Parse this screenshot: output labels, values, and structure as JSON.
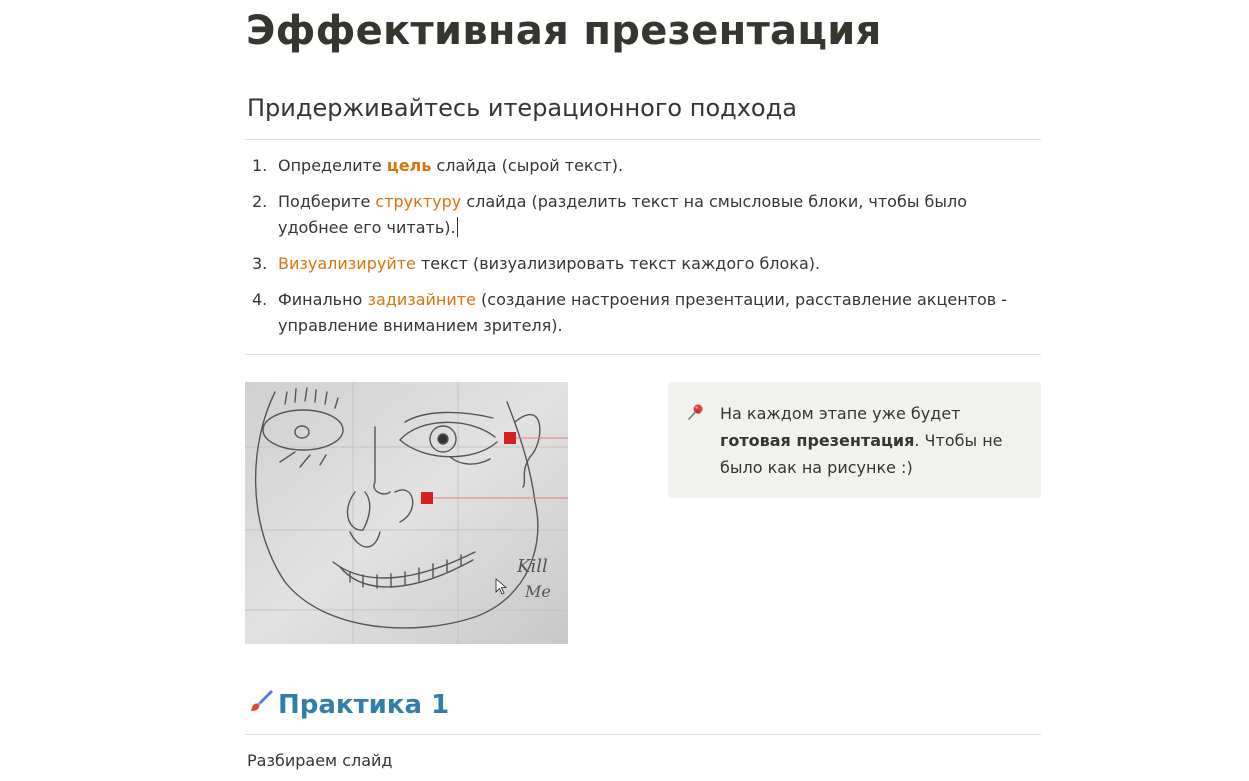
{
  "page": {
    "title": "Эффективная презентация",
    "subtitle": "Придерживайтесь итерационного подхода"
  },
  "steps": [
    {
      "num": "1.",
      "before": "Определите ",
      "highlight": "цель",
      "after": " слайда (сырой текст)."
    },
    {
      "num": "2.",
      "before": "Подберите ",
      "highlight": "структуру",
      "after": " слайда (разделить текст на смысловые блоки, чтобы было удобнее его читать)."
    },
    {
      "num": "3.",
      "before": "",
      "highlight": "Визуализируйте",
      "after": " текст (визуализировать текст каждого блока)."
    },
    {
      "num": "4.",
      "before": "Финально ",
      "highlight": "задизайните",
      "after": " (создание настроения презентации, расставление акцентов - управление вниманием зрителя)."
    }
  ],
  "callout": {
    "icon": "pushpin-icon",
    "text_before": "На каждом этапе уже будет ",
    "text_bold": "готовая презентация",
    "text_after": ". Чтобы не было как на рисунке :)"
  },
  "sketch": {
    "handwriting_line1": "Kill",
    "handwriting_line2": "Me"
  },
  "practice": {
    "icon": "paintbrush-icon",
    "heading": "Практика 1",
    "body": "Разбираем слайд"
  },
  "colors": {
    "text": "#37352f",
    "accent_orange": "#d9730d",
    "heading_blue": "#337ea9",
    "callout_bg": "#f1f1ef",
    "divider": "#e3e2e0"
  }
}
